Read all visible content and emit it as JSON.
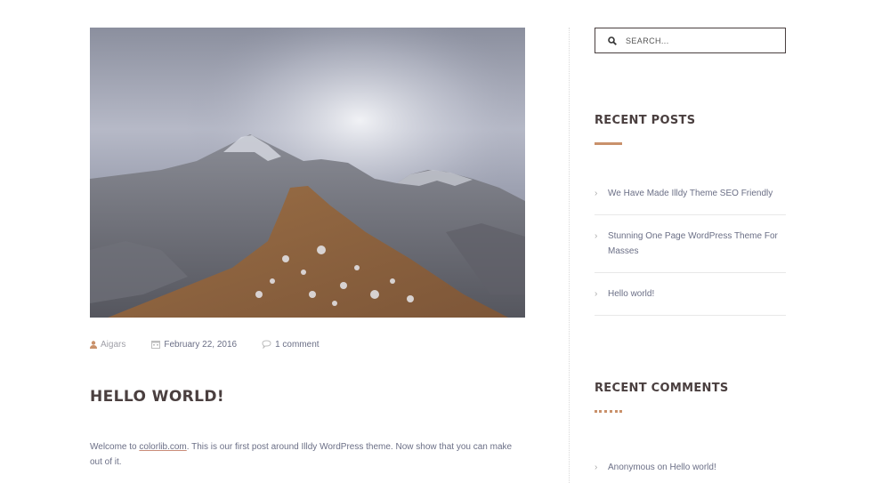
{
  "post": {
    "image_alt": "mountain landscape",
    "meta": {
      "author": "Aigars",
      "date": "February 22, 2016",
      "comments": "1 comment"
    },
    "title": "HELLO WORLD!",
    "excerpt": {
      "before_link": "Welcome to ",
      "link_text": "colorlib.com",
      "after_link": ". This is our first post around Illdy WordPress theme. Now show that you can make out of it."
    }
  },
  "sidebar": {
    "search": {
      "placeholder": "SEARCH..."
    },
    "recent_posts": {
      "title": "RECENT POSTS",
      "items": [
        {
          "label": "We Have Made Illdy Theme SEO Friendly"
        },
        {
          "label": "Stunning One Page WordPress Theme For Masses"
        },
        {
          "label": "Hello world!"
        }
      ]
    },
    "recent_comments": {
      "title": "RECENT COMMENTS",
      "items": [
        {
          "author": "Anonymous",
          "connector": " on ",
          "post": "Hello world!"
        }
      ]
    }
  },
  "colors": {
    "accent": "#c9916b",
    "heading": "#4a3f3f",
    "text": "#6b6f86"
  },
  "icons": [
    "user-icon",
    "calendar-icon",
    "comment-icon",
    "search-icon",
    "chevron-right-icon"
  ]
}
